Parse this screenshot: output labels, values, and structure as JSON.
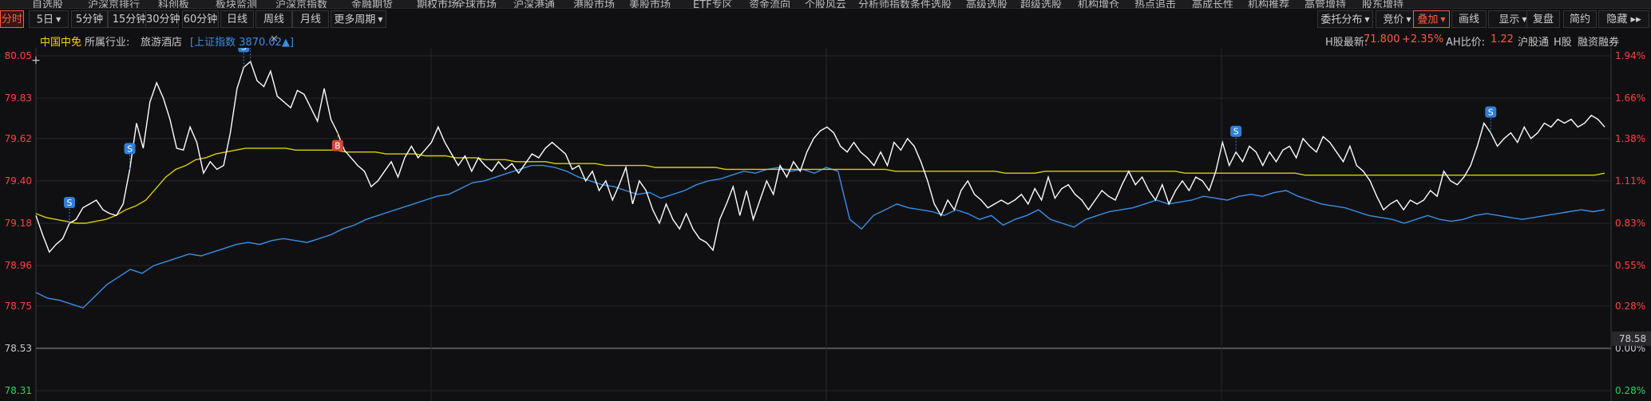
{
  "topnav": [
    "自选股",
    "沪深京排行",
    "科创板",
    "板块监测",
    "沪深京指数",
    "金融期货",
    "期权市场",
    "全球市场",
    "沪深港通",
    "港股市场",
    "美股市场",
    "ETF专区",
    "资金流向",
    "个股风云",
    "分析师指数",
    "条件选股",
    "高级选股",
    "超级选股",
    "机构增仓",
    "热点追击",
    "高成长性",
    "机构推荐",
    "高管增持",
    "股东增持"
  ],
  "periods": [
    {
      "label": "分时",
      "active": true
    },
    {
      "label": "5日",
      "dropdown": true
    },
    {
      "label": "5分钟"
    },
    {
      "label": "15分钟"
    },
    {
      "label": "30分钟"
    },
    {
      "label": "60分钟"
    },
    {
      "label": "日线"
    },
    {
      "label": "周线"
    },
    {
      "label": "月线"
    },
    {
      "label": "更多周期",
      "dropdown": true
    }
  ],
  "tools": [
    {
      "label": "委托分布",
      "dropdown": true
    },
    {
      "label": "竞价",
      "dropdown": true
    },
    {
      "label": "叠加",
      "dropdown": true,
      "highlight": true
    },
    {
      "label": "画线"
    },
    {
      "label": "显示",
      "dropdown": true
    },
    {
      "label": "复盘"
    },
    {
      "label": "简约"
    },
    {
      "label": "隐藏 ▸▸"
    }
  ],
  "info": {
    "stock_name": "中国中免",
    "industry_label": "所属行业:",
    "industry": "旅游酒店",
    "overlay_index": "[上证指数 3870.02▲]",
    "close": "✕",
    "h_share_label": "H股最新:",
    "h_share_price": "71.800",
    "h_share_change": "+2.35%",
    "ah_label": "AH比价:",
    "ah_value": "1.22",
    "tag_hgt": "沪股通",
    "tag_h": "H股",
    "tag_margin": "融资融券"
  },
  "chart_data": {
    "type": "line",
    "left_axis": [
      "80.05",
      "79.83",
      "79.62",
      "79.40",
      "79.18",
      "78.96",
      "78.75",
      "78.53",
      "78.31"
    ],
    "right_axis": [
      "1.94%",
      "1.66%",
      "1.38%",
      "1.11%",
      "0.83%",
      "0.55%",
      "0.28%",
      "0.00%",
      "0.28%"
    ],
    "baseline": 78.53,
    "ylim": [
      78.31,
      80.05
    ],
    "current_value_tag": "78.58",
    "colors": {
      "price": "#ffffff",
      "avg": "#d8d000",
      "index": "#3a8ee6",
      "up": "#ff4040",
      "down": "#2fd060",
      "marker": "#2f7fd6",
      "buy": "#d6443a"
    },
    "series": [
      {
        "name": "price",
        "values": [
          79.22,
          79.12,
          79.03,
          79.07,
          79.1,
          79.18,
          79.2,
          79.26,
          79.28,
          79.3,
          79.25,
          79.23,
          79.22,
          79.28,
          79.46,
          79.7,
          79.57,
          79.81,
          79.91,
          79.83,
          79.72,
          79.57,
          79.56,
          79.68,
          79.6,
          79.44,
          79.5,
          79.46,
          79.48,
          79.65,
          79.88,
          79.99,
          80.02,
          79.92,
          79.89,
          79.97,
          79.84,
          79.81,
          79.78,
          79.87,
          79.85,
          79.78,
          79.71,
          79.88,
          79.72,
          79.65,
          79.56,
          79.52,
          79.48,
          79.45,
          79.37,
          79.4,
          79.45,
          79.5,
          79.42,
          79.52,
          79.58,
          79.52,
          79.56,
          79.6,
          79.68,
          79.6,
          79.54,
          79.48,
          79.53,
          79.45,
          79.52,
          79.48,
          79.45,
          79.5,
          79.46,
          79.49,
          79.44,
          79.49,
          79.54,
          79.52,
          79.57,
          79.6,
          79.57,
          79.54,
          79.46,
          79.48,
          79.4,
          79.45,
          79.35,
          79.4,
          79.3,
          79.38,
          79.47,
          79.28,
          79.4,
          79.35,
          79.25,
          79.18,
          79.28,
          79.2,
          79.15,
          79.23,
          79.15,
          79.1,
          79.08,
          79.04,
          79.2,
          79.28,
          79.37,
          79.22,
          79.35,
          79.2,
          79.3,
          79.4,
          79.33,
          79.48,
          79.42,
          79.5,
          79.45,
          79.55,
          79.62,
          79.66,
          79.68,
          79.65,
          79.58,
          79.55,
          79.6,
          79.55,
          79.52,
          79.48,
          79.55,
          79.48,
          79.6,
          79.56,
          79.62,
          79.58,
          79.5,
          79.4,
          79.28,
          79.22,
          79.3,
          79.25,
          79.35,
          79.4,
          79.33,
          79.3,
          79.26,
          79.28,
          79.3,
          79.28,
          79.3,
          79.33,
          79.28,
          79.36,
          79.3,
          79.42,
          79.31,
          79.36,
          79.38,
          79.33,
          79.3,
          79.25,
          79.3,
          79.35,
          79.32,
          79.3,
          79.38,
          79.45,
          79.38,
          79.42,
          79.35,
          79.3,
          79.38,
          79.28,
          79.35,
          79.4,
          79.35,
          79.42,
          79.4,
          79.35,
          79.45,
          79.6,
          79.48,
          79.55,
          79.5,
          79.58,
          79.55,
          79.48,
          79.55,
          79.5,
          79.56,
          79.58,
          79.52,
          79.62,
          79.58,
          79.55,
          79.63,
          79.6,
          79.55,
          79.5,
          79.58,
          79.48,
          79.45,
          79.4,
          79.32,
          79.25,
          79.28,
          79.3,
          79.25,
          79.3,
          79.28,
          79.3,
          79.35,
          79.32,
          79.45,
          79.4,
          79.38,
          79.42,
          79.48,
          79.58,
          79.7,
          79.65,
          79.58,
          79.62,
          79.65,
          79.6,
          79.68,
          79.62,
          79.65,
          79.7,
          79.68,
          79.72,
          79.7,
          79.72,
          79.68,
          79.7,
          79.74,
          79.72,
          79.68
        ]
      },
      {
        "name": "avg",
        "values": [
          79.23,
          79.21,
          79.2,
          79.19,
          79.18,
          79.18,
          79.19,
          79.2,
          79.22,
          79.25,
          79.27,
          79.3,
          79.36,
          79.42,
          79.46,
          79.48,
          79.51,
          79.52,
          79.54,
          79.55,
          79.56,
          79.57,
          79.57,
          79.57,
          79.57,
          79.57,
          79.56,
          79.56,
          79.56,
          79.56,
          79.56,
          79.55,
          79.55,
          79.55,
          79.55,
          79.54,
          79.54,
          79.54,
          79.54,
          79.53,
          79.53,
          79.53,
          79.52,
          79.52,
          79.52,
          79.51,
          79.51,
          79.51,
          79.5,
          79.5,
          79.5,
          79.5,
          79.49,
          79.49,
          79.49,
          79.49,
          79.49,
          79.48,
          79.48,
          79.48,
          79.48,
          79.48,
          79.47,
          79.47,
          79.47,
          79.47,
          79.47,
          79.47,
          79.47,
          79.46,
          79.46,
          79.46,
          79.46,
          79.46,
          79.46,
          79.46,
          79.46,
          79.46,
          79.46,
          79.46,
          79.46,
          79.46,
          79.46,
          79.46,
          79.46,
          79.46,
          79.45,
          79.45,
          79.45,
          79.45,
          79.45,
          79.45,
          79.45,
          79.45,
          79.45,
          79.45,
          79.45,
          79.44,
          79.44,
          79.44,
          79.44,
          79.45,
          79.45,
          79.45,
          79.45,
          79.45,
          79.45,
          79.45,
          79.45,
          79.45,
          79.45,
          79.45,
          79.45,
          79.45,
          79.45,
          79.44,
          79.44,
          79.44,
          79.44,
          79.44,
          79.44,
          79.44,
          79.44,
          79.44,
          79.44,
          79.44,
          79.44,
          79.43,
          79.43,
          79.43,
          79.43,
          79.43,
          79.43,
          79.43,
          79.43,
          79.43,
          79.43,
          79.43,
          79.43,
          79.43,
          79.43,
          79.43,
          79.43,
          79.43,
          79.43,
          79.43,
          79.43,
          79.43,
          79.43,
          79.43,
          79.43,
          79.43,
          79.43,
          79.43,
          79.43,
          79.43,
          79.43,
          79.44
        ]
      },
      {
        "name": "index",
        "values": [
          78.82,
          78.79,
          78.78,
          78.76,
          78.74,
          78.8,
          78.86,
          78.9,
          78.94,
          78.92,
          78.96,
          78.98,
          79.0,
          79.02,
          79.01,
          79.03,
          79.05,
          79.07,
          79.08,
          79.07,
          79.09,
          79.1,
          79.09,
          79.08,
          79.1,
          79.12,
          79.15,
          79.17,
          79.2,
          79.22,
          79.24,
          79.26,
          79.28,
          79.3,
          79.32,
          79.33,
          79.36,
          79.39,
          79.4,
          79.42,
          79.44,
          79.46,
          79.48,
          79.48,
          79.47,
          79.45,
          79.42,
          79.4,
          79.38,
          79.37,
          79.35,
          79.33,
          79.34,
          79.31,
          79.33,
          79.35,
          79.38,
          79.4,
          79.41,
          79.43,
          79.45,
          79.44,
          79.46,
          79.47,
          79.45,
          79.46,
          79.44,
          79.47,
          79.45,
          79.2,
          79.15,
          79.22,
          79.25,
          79.28,
          79.26,
          79.25,
          79.24,
          79.22,
          79.25,
          79.23,
          79.2,
          79.22,
          79.17,
          79.2,
          79.22,
          79.25,
          79.2,
          79.18,
          79.16,
          79.2,
          79.22,
          79.24,
          79.25,
          79.26,
          79.28,
          79.3,
          79.28,
          79.29,
          79.3,
          79.32,
          79.31,
          79.3,
          79.32,
          79.33,
          79.32,
          79.34,
          79.35,
          79.32,
          79.3,
          79.28,
          79.27,
          79.26,
          79.24,
          79.22,
          79.21,
          79.2,
          79.18,
          79.2,
          79.22,
          79.2,
          79.19,
          79.2,
          79.22,
          79.23,
          79.22,
          79.21,
          79.2,
          79.21,
          79.22,
          79.23,
          79.24,
          79.25,
          79.24,
          79.25
        ]
      }
    ],
    "markers": [
      {
        "label": "S",
        "index": 5
      },
      {
        "label": "S",
        "index": 14
      },
      {
        "label": "S",
        "index": 31
      },
      {
        "label": "S",
        "index": 32
      },
      {
        "label": "B",
        "index": 45
      },
      {
        "label": "S",
        "index": 179
      },
      {
        "label": "S",
        "index": 217
      }
    ]
  }
}
